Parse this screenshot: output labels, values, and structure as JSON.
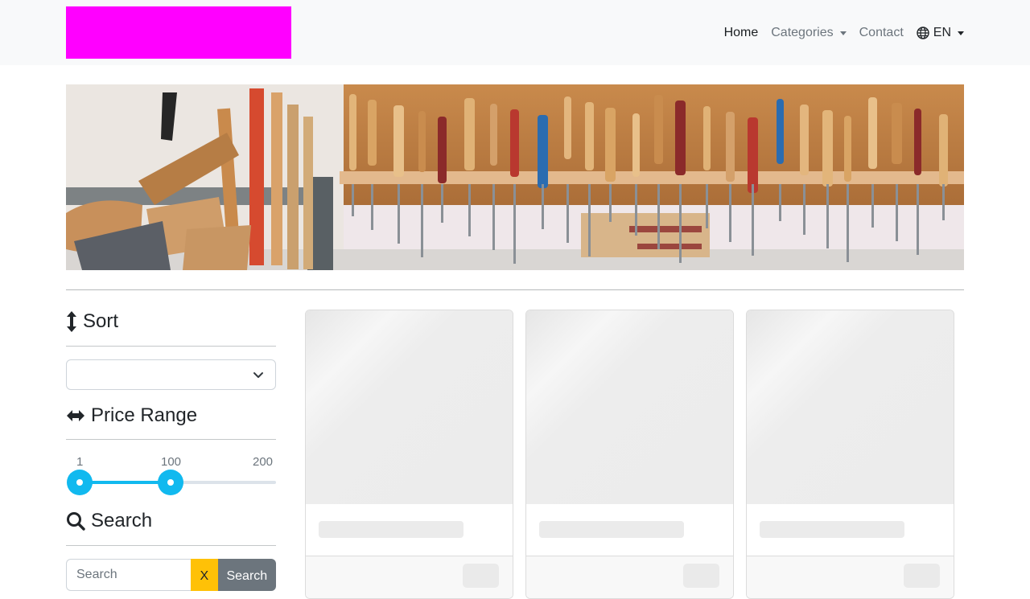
{
  "nav": {
    "home": "Home",
    "categories": "Categories",
    "contact": "Contact",
    "language": "EN",
    "icons": {
      "language": "globe-icon",
      "dropdown": "caret-down-icon"
    }
  },
  "hero": {
    "icon": "workshop-tools-banner-image"
  },
  "sidebar": {
    "sort": {
      "title": "Sort",
      "icon": "arrows-vertical-icon",
      "selected": ""
    },
    "price": {
      "title": "Price Range",
      "icon": "arrows-horizontal-icon",
      "min": "1",
      "current": "100",
      "max": "200",
      "value_fraction": 0.4975
    },
    "search": {
      "title": "Search",
      "icon": "search-icon",
      "placeholder": "Search",
      "value": "",
      "clear_label": "X",
      "submit_label": "Search"
    }
  },
  "products": {
    "state": "loading-placeholders",
    "count": 3
  },
  "colors": {
    "logo": "#ff00ff",
    "accent": "#11b9ef",
    "clear_button": "#ffc107",
    "search_button": "#6c757d",
    "navbar": "#f8f9fa"
  }
}
